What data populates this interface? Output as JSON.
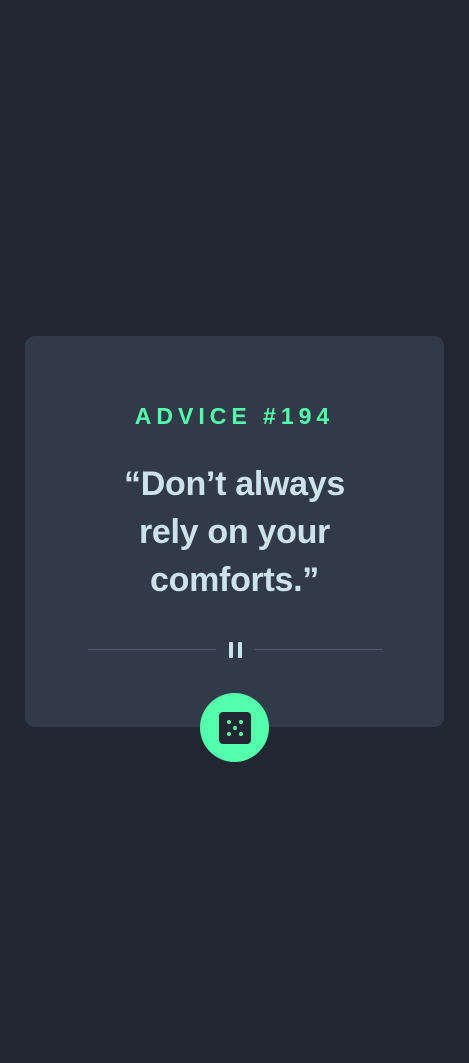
{
  "advice": {
    "label": "ADVICE #194",
    "quote": "“Don’t always rely on your comforts.”"
  },
  "colors": {
    "background": "#202632",
    "card": "#313a48",
    "accent": "#53ffaa",
    "text": "#cee3e9",
    "divider": "#4f5d74"
  },
  "icons": {
    "divider": "pause-icon",
    "button": "dice-icon"
  }
}
